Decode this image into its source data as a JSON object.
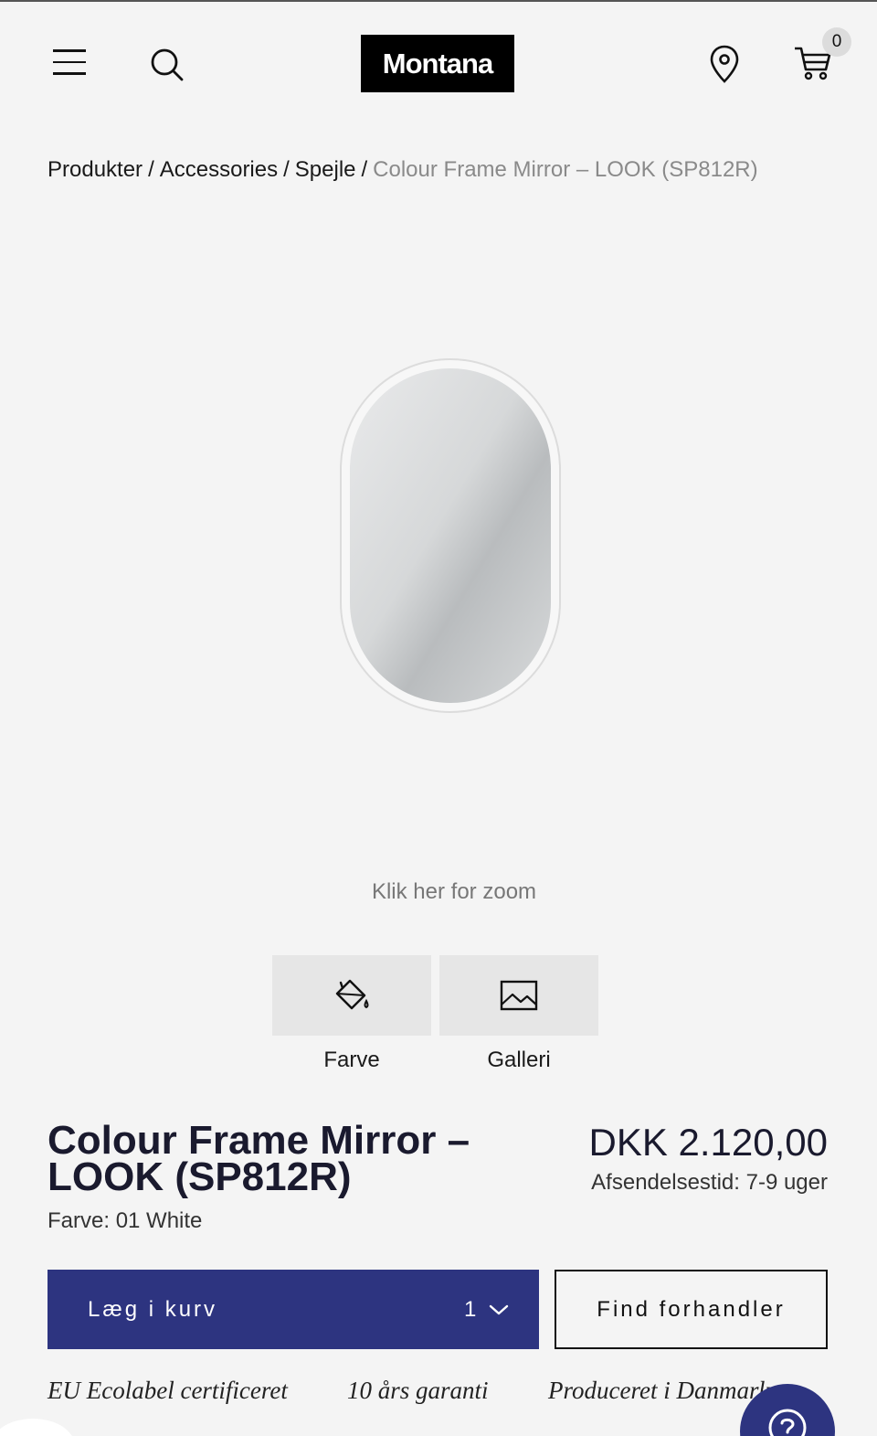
{
  "header": {
    "logo_text": "Montana",
    "cart_count": "0"
  },
  "breadcrumb": {
    "items": [
      "Produkter",
      "Accessories",
      "Spejle"
    ],
    "separator": "/",
    "current": "Colour Frame Mirror – LOOK (SP812R)"
  },
  "gallery": {
    "zoom_hint": "Klik her for zoom"
  },
  "options": {
    "farve_label": "Farve",
    "galleri_label": "Galleri"
  },
  "product": {
    "title": "Colour Frame Mirror – LOOK (SP812R)",
    "color_label": "Farve:",
    "color_value": "01 White",
    "price": "DKK 2.120,00",
    "shipping": "Afsendelsestid: 7-9 uger"
  },
  "actions": {
    "add_to_cart_label": "Læg i kurv",
    "quantity": "1",
    "find_dealer_label": "Find forhandler"
  },
  "usps": [
    "EU Ecolabel certificeret",
    "10 års garanti",
    "Produceret i Danmark"
  ],
  "colors": {
    "accent": "#2d3480",
    "background": "#f4f4f4",
    "tile": "#e6e6e6"
  }
}
